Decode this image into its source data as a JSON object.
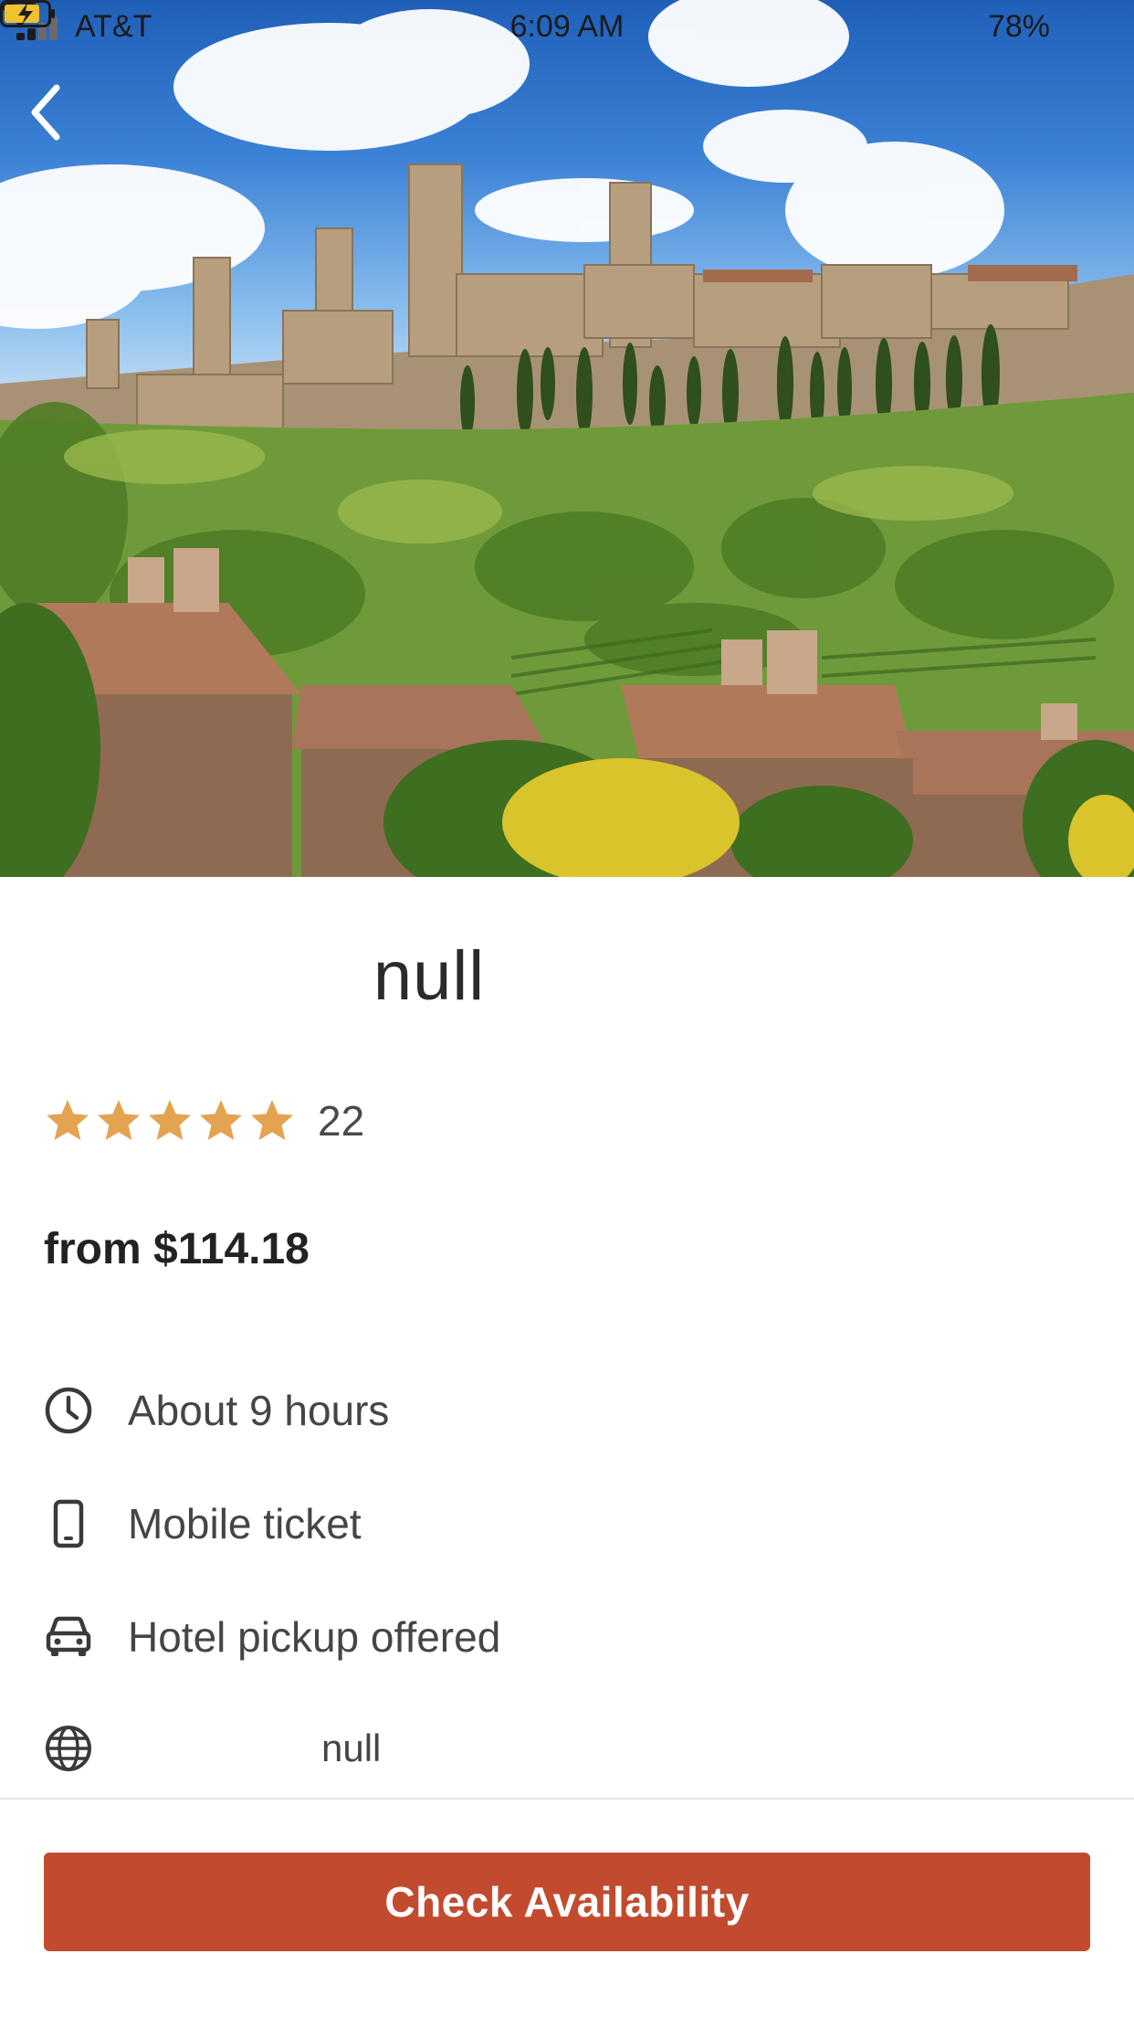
{
  "status_bar": {
    "carrier": "AT&T",
    "time": "6:09 AM",
    "battery": "78%"
  },
  "tour": {
    "title": "null",
    "rating_value": 5,
    "rating_max": 5,
    "review_count": "22",
    "price": "from $114.18"
  },
  "features": [
    {
      "icon": "clock-icon",
      "text": "About 9 hours"
    },
    {
      "icon": "phone-icon",
      "text": "Mobile ticket"
    },
    {
      "icon": "car-icon",
      "text": "Hotel pickup offered"
    },
    {
      "icon": "globe-icon",
      "text": "null"
    }
  ],
  "cta": {
    "label": "Check Availability"
  },
  "colors": {
    "accent": "#c24b2f",
    "star": "#e4a350",
    "text": "#2b2b2b"
  }
}
